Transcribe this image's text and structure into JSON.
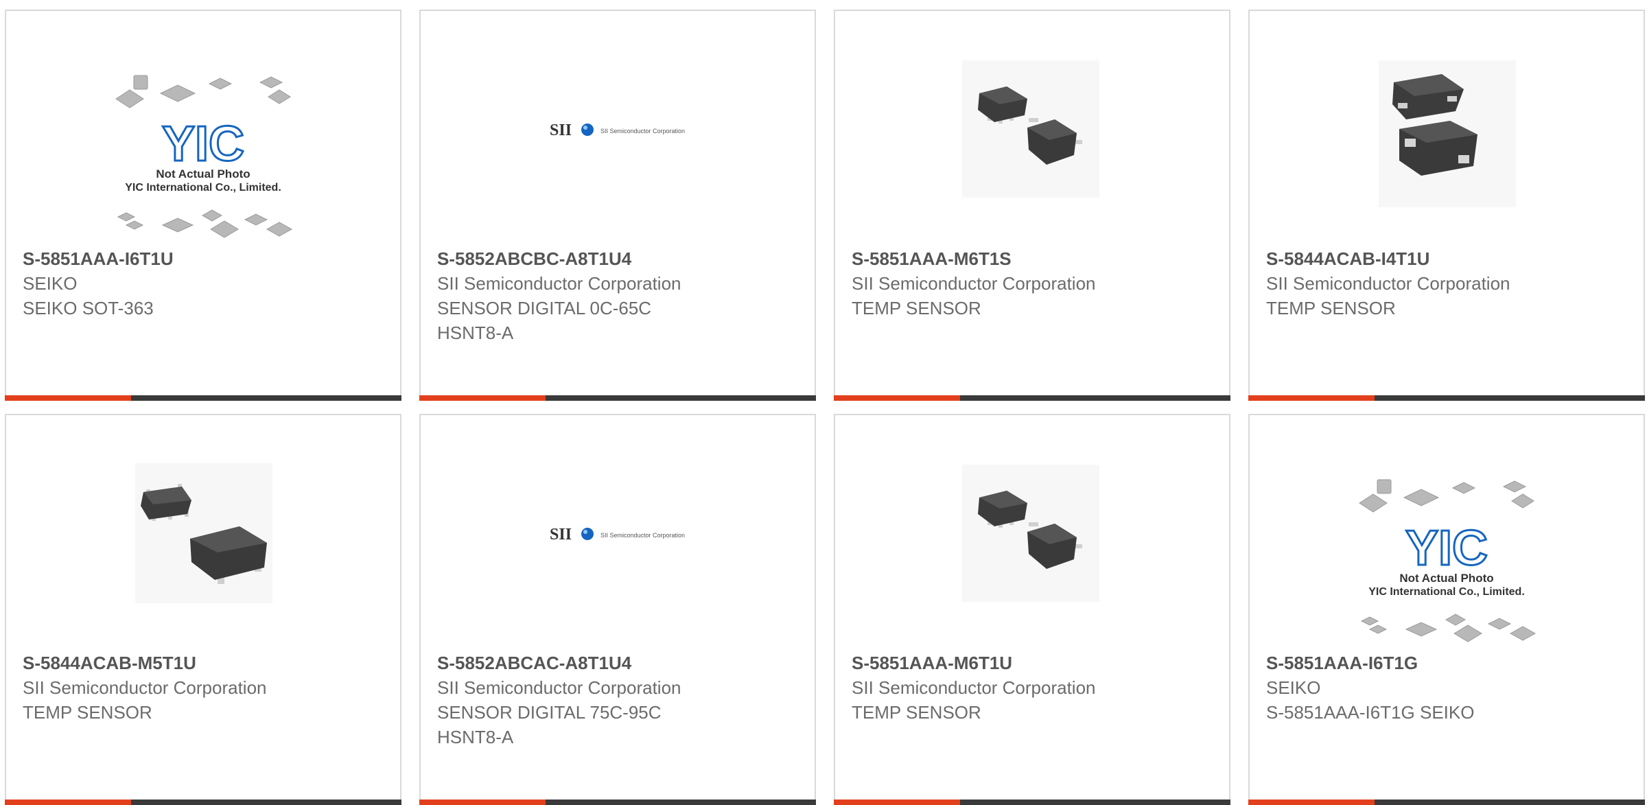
{
  "products": [
    {
      "part_number": "S-5851AAA-I6T1U",
      "manufacturer": "SEIKO",
      "description": "SEIKO SOT-363",
      "image": "yic-placeholder",
      "placeholder": {
        "line1": "Not Actual Photo",
        "line2": "YIC International Co., Limited."
      }
    },
    {
      "part_number": "S-5852ABCBC-A8T1U4",
      "manufacturer": "SII Semiconductor Corporation",
      "description": "SENSOR DIGITAL 0C-65C\nHSNT8-A",
      "image": "sii-logo",
      "logo": {
        "mark": "SII",
        "company": "SII Semiconductor Corporation"
      }
    },
    {
      "part_number": "S-5851AAA-M6T1S",
      "manufacturer": "SII Semiconductor Corporation",
      "description": "TEMP SENSOR",
      "image": "chip-sot363-photo"
    },
    {
      "part_number": "S-5844ACAB-I4T1U",
      "manufacturer": "SII Semiconductor Corporation",
      "description": "TEMP SENSOR",
      "image": "chip-dfn-photo"
    },
    {
      "part_number": "S-5844ACAB-M5T1U",
      "manufacturer": "SII Semiconductor Corporation",
      "description": "TEMP SENSOR",
      "image": "chip-sot23-photo"
    },
    {
      "part_number": "S-5852ABCAC-A8T1U4",
      "manufacturer": "SII Semiconductor Corporation",
      "description": "SENSOR DIGITAL 75C-95C\nHSNT8-A",
      "image": "sii-logo",
      "logo": {
        "mark": "SII",
        "company": "SII Semiconductor Corporation"
      }
    },
    {
      "part_number": "S-5851AAA-M6T1U",
      "manufacturer": "SII Semiconductor Corporation",
      "description": "TEMP SENSOR",
      "image": "chip-sot363-photo"
    },
    {
      "part_number": "S-5851AAA-I6T1G",
      "manufacturer": "SEIKO",
      "description": "S-5851AAA-I6T1G SEIKO",
      "image": "yic-placeholder",
      "placeholder": {
        "line1": "Not Actual Photo",
        "line2": "YIC International Co., Limited."
      }
    }
  ],
  "colors": {
    "accent": "#e2401c",
    "bar": "#3a3a3a",
    "border": "#d9d9d9",
    "text": "#6b6b6b",
    "title": "#555555",
    "yic_blue": "#1565c0"
  }
}
